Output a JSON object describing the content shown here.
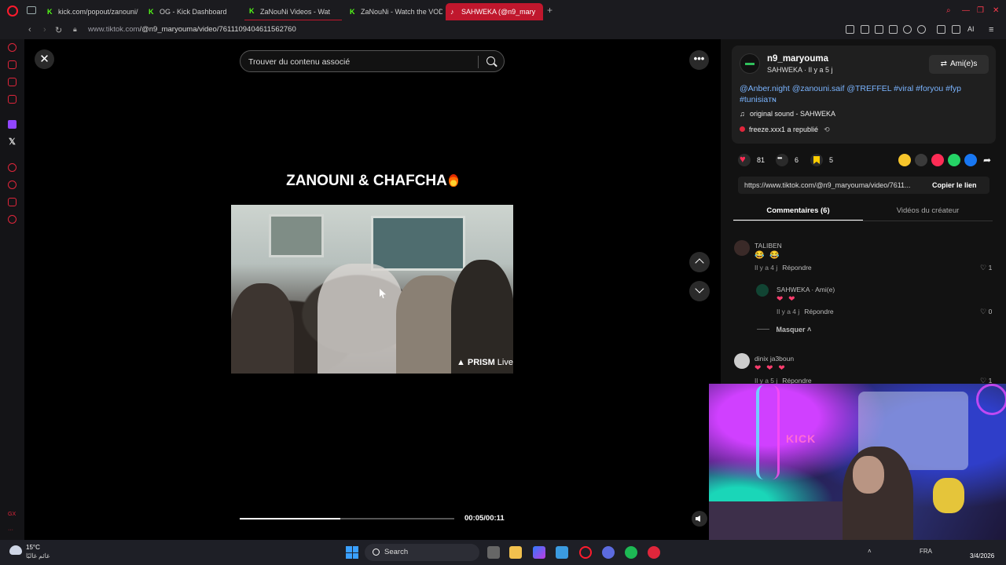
{
  "browser": {
    "tabs": [
      {
        "label": "kick.com/popout/zanouni/",
        "icon": "kick-favicon"
      },
      {
        "label": "OG - Kick Dashboard",
        "icon": "kick-favicon"
      },
      {
        "label": "ZaNouNi Videos - Wat",
        "icon": "kick-favicon-muted"
      },
      {
        "label": "ZaNouNi - Watch the VOD",
        "icon": "kick-favicon"
      },
      {
        "label": "SAHWEKA (@n9_mary",
        "icon": "tiktok-favicon",
        "active": true
      }
    ],
    "url_host": "www.tiktok.com",
    "url_path": "/@n9_maryouma/video/7611109404611562760",
    "ai_label": "AI"
  },
  "sidebar": {
    "bottom_label": "GX"
  },
  "video": {
    "search_placeholder": "Trouver du contenu associé",
    "overlay_title": "ZANOUNI & CHAFCHA",
    "watermark_brand": "PRISM",
    "watermark_suffix": " Live",
    "time": "00:05/00:11",
    "progress": 0.47
  },
  "post": {
    "author": "n9_maryouma",
    "author_sub": "SAHWEKA · Il y a 5 j",
    "friends_label": "Ami(e)s",
    "caption": "@Anber.night @zanouni.saif @TREFFEL #viral #foryou #fyp #tunisiaᴛɴ",
    "sound": "original sound - SAHWEKA",
    "repost": "freeze.xxx1 a republié",
    "likes": "81",
    "comments": "6",
    "saves": "5",
    "link": "https://www.tiktok.com/@n9_maryouma/video/7611...",
    "copy_label": "Copier le lien",
    "tab_comments": "Commentaires (6)",
    "tab_videos": "Vidéos du créateur",
    "share_colors": [
      "#f7c52b",
      "#3a3a3a",
      "#fe2c55",
      "#25d366",
      "#1877f2"
    ]
  },
  "comments": [
    {
      "user": "TALIBEN",
      "emoji": "😂 😂",
      "time": "Il y a 4 j",
      "reply": "Répondre",
      "likes": "1"
    },
    {
      "user": "SAHWEKA · Ami(e)",
      "emoji": "❤ ❤",
      "time": "Il y a 4 j",
      "reply": "Répondre",
      "likes": "0"
    },
    {
      "hide": "Masquer"
    },
    {
      "user": "dinix ja3boun",
      "emoji": "❤ ❤ ❤",
      "time": "Il y a 5 j",
      "reply": "Répondre",
      "likes": "1"
    }
  ],
  "taskbar": {
    "temp": "15°C",
    "weather": "غائم غالبًا",
    "search": "Search",
    "lang": "FRA",
    "date": "3/4/2026"
  }
}
